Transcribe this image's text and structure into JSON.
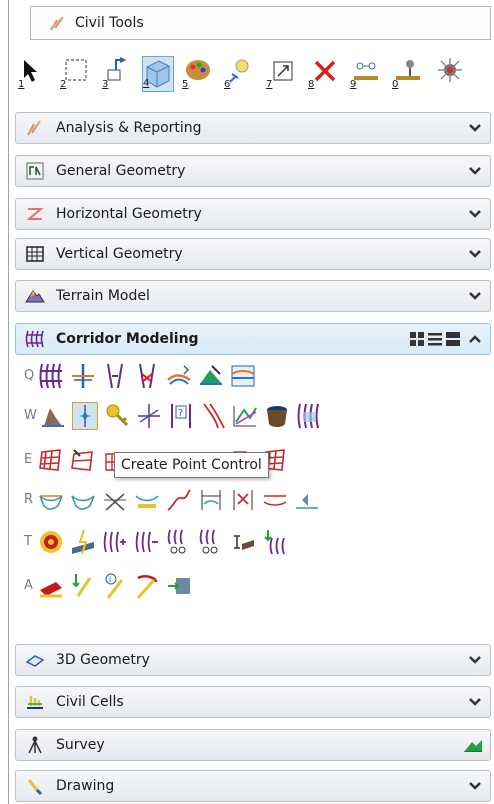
{
  "panel": {
    "title": "Civil Tools"
  },
  "task_toolbar": {
    "items": [
      {
        "number": "1",
        "icon": "arrow-select-icon"
      },
      {
        "number": "2",
        "icon": "dashed-select-icon"
      },
      {
        "number": "3",
        "icon": "move-arrow-icon"
      },
      {
        "number": "4",
        "icon": "cube-icon",
        "active": true
      },
      {
        "number": "5",
        "icon": "palette-icon"
      },
      {
        "number": "6",
        "icon": "bulb-scatter-icon"
      },
      {
        "number": "7",
        "icon": "scale-box-icon"
      },
      {
        "number": "8",
        "icon": "delete-x-icon"
      },
      {
        "number": "9",
        "icon": "measure-icon"
      },
      {
        "number": "0",
        "icon": "survey-level-icon"
      },
      {
        "number": "",
        "icon": "burst-icon"
      }
    ]
  },
  "sections": {
    "analysis": {
      "label": "Analysis & Reporting",
      "icon": "feather-chart-icon"
    },
    "general": {
      "label": "General Geometry",
      "icon": "general-geometry-icon"
    },
    "horizontal": {
      "label": "Horizontal Geometry",
      "icon": "horizontal-z-icon"
    },
    "vertical": {
      "label": "Vertical Geometry",
      "icon": "grid-table-icon"
    },
    "terrain": {
      "label": "Terrain Model",
      "icon": "terrain-mountain-icon"
    },
    "corridor": {
      "label": "Corridor Modeling",
      "icon": "corridor-icon"
    },
    "geom3d": {
      "label": "3D Geometry",
      "icon": "3d-geometry-icon"
    },
    "civilcells": {
      "label": "Civil Cells",
      "icon": "civil-cells-icon"
    },
    "survey": {
      "label": "Survey",
      "icon": "survey-tripod-icon"
    },
    "drawing": {
      "label": "Drawing",
      "icon": "drawing-icon"
    }
  },
  "corridor_rows": [
    {
      "key": "Q",
      "count": 8
    },
    {
      "key": "W",
      "count": 10
    },
    {
      "key": "E",
      "count": 9
    },
    {
      "key": "R",
      "count": 9
    },
    {
      "key": "T",
      "count": 8
    },
    {
      "key": "A",
      "count": 5
    }
  ],
  "tooltip": {
    "text": "Create Point Control"
  },
  "colors": {
    "accent": "#6aa3d8",
    "tooltip_border": "#767676",
    "selected_border": "#e0a020"
  }
}
